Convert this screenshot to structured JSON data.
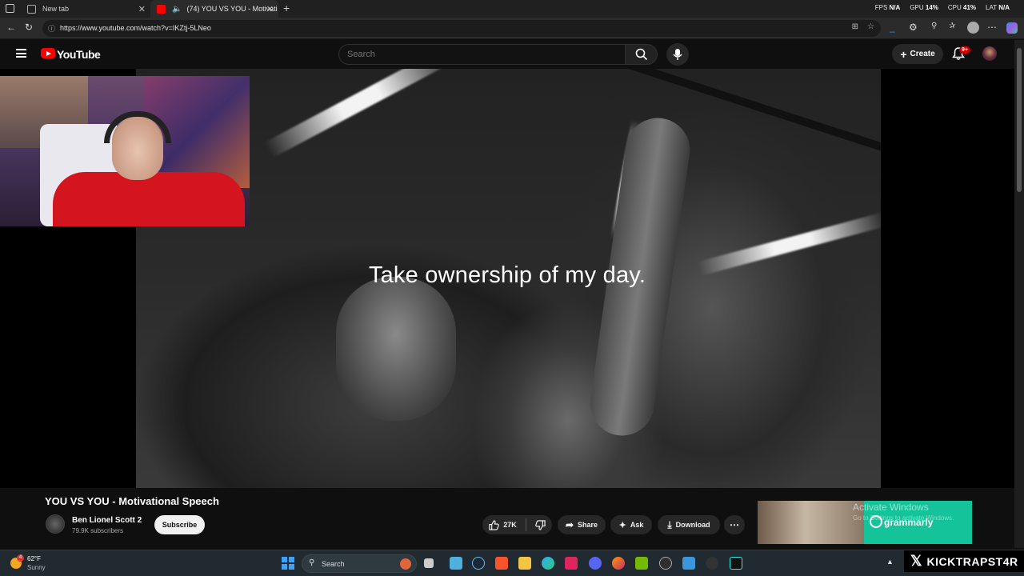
{
  "browser": {
    "tabs": [
      {
        "label": "New tab"
      },
      {
        "label": "(74) YOU VS YOU - Motivati"
      }
    ],
    "url": "https://www.youtube.com/watch?v=IKZtj-5LNeo",
    "stats": {
      "fps_label": "FPS",
      "fps_value": "N/A",
      "gpu_label": "GPU",
      "gpu_value": "14%",
      "cpu_label": "CPU",
      "cpu_value": "41%",
      "lat_label": "LAT",
      "lat_value": "N/A"
    }
  },
  "youtube": {
    "logo_text": "YouTube",
    "search_placeholder": "Search",
    "create_label": "Create",
    "notification_badge": "9+"
  },
  "video": {
    "caption": "Take ownership of my day.",
    "title": "YOU VS YOU - Motivational Speech",
    "channel": "Ben Lionel Scott 2",
    "subscribers": "79.9K subscribers",
    "subscribe_label": "Subscribe",
    "likes": "27K",
    "share_label": "Share",
    "ask_label": "Ask",
    "download_label": "Download"
  },
  "ad": {
    "brand": "grammarly"
  },
  "watermark": {
    "line1": "Activate Windows",
    "line2": "Go to Settings to activate Windows."
  },
  "taskbar": {
    "temperature": "62°F",
    "condition": "Sunny",
    "weather_badge": "4",
    "search_label": "Search"
  },
  "overlay": {
    "streamer_name": "KICKTRAPST4R"
  },
  "colors": {
    "youtube_red": "#ff0000",
    "grammarly_green": "#15c39a",
    "badge_red": "#cc0000"
  }
}
